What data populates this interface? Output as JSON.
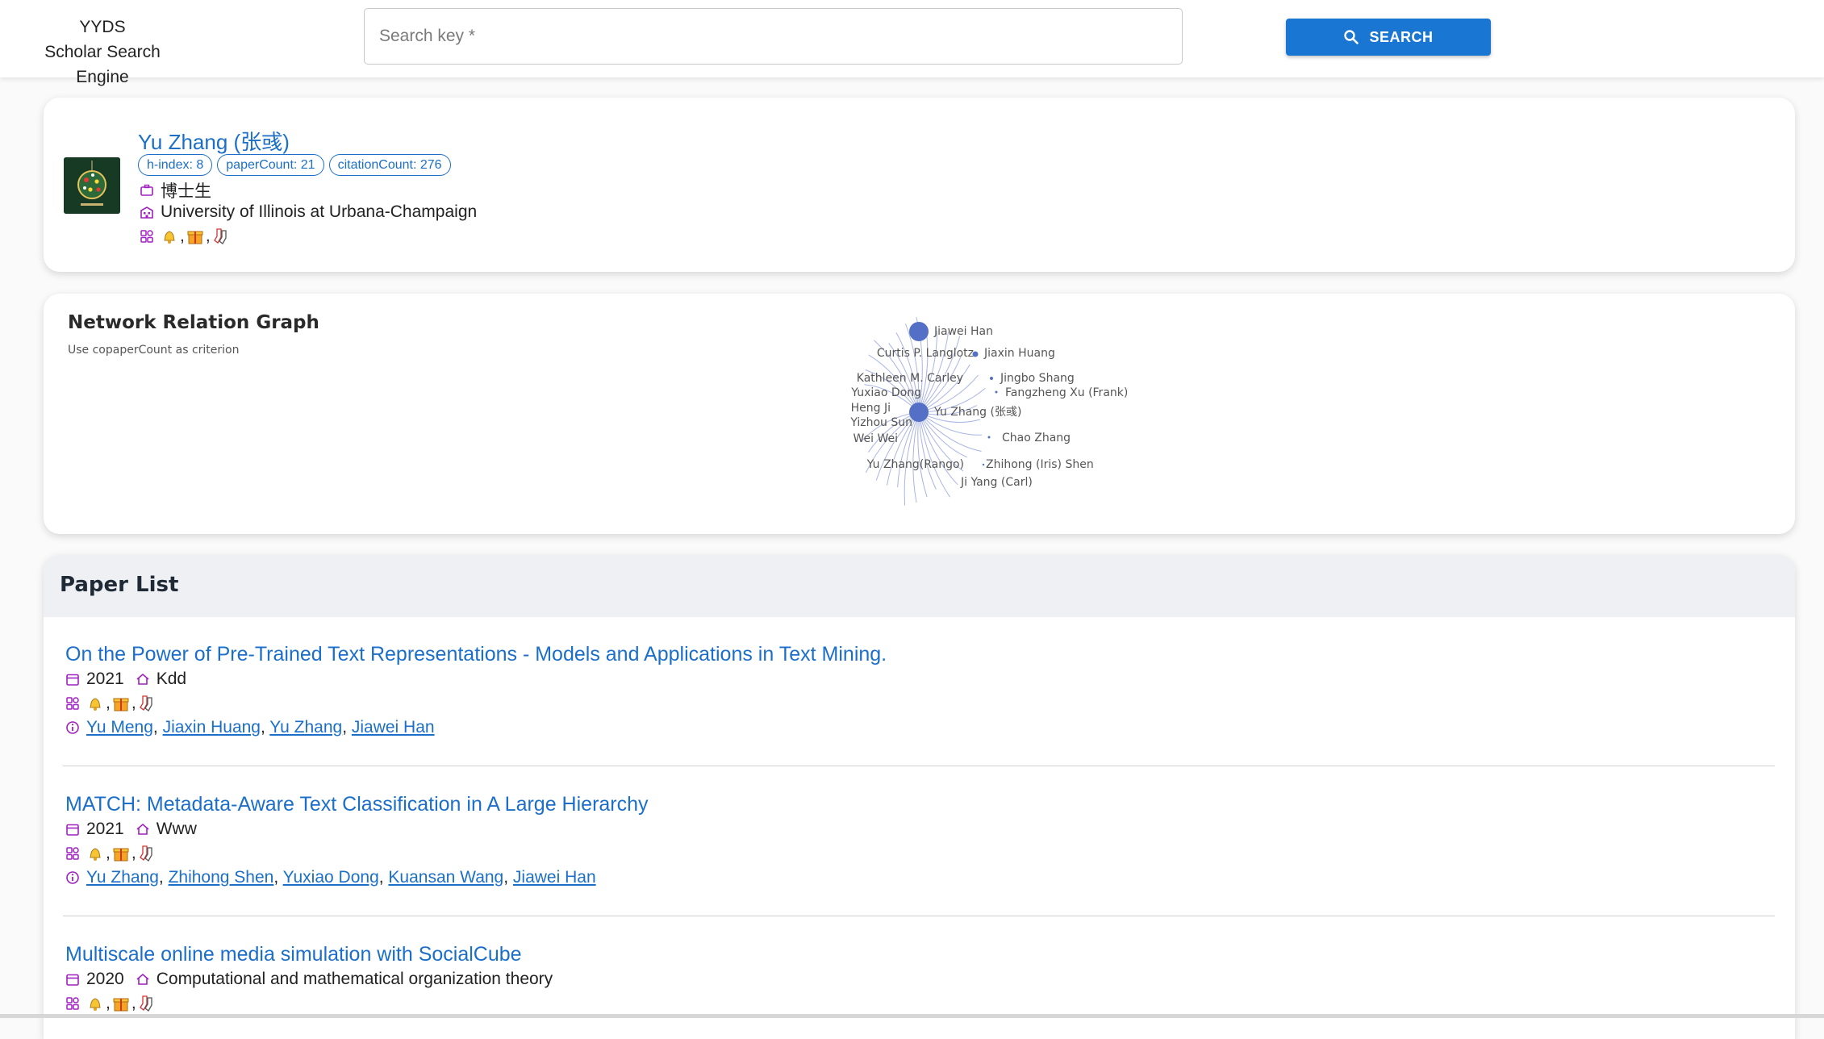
{
  "header": {
    "brand_line1": "YYDS",
    "brand_line2": "Scholar Search Engine",
    "search_placeholder": "Search key *",
    "search_value": "",
    "search_button": "SEARCH"
  },
  "profile": {
    "name": "Yu Zhang (张彧)",
    "chips": [
      "h-index: 8",
      "paperCount: 21",
      "citationCount: 276"
    ],
    "position": "博士生",
    "affiliation": "University of Illinois at Urbana-Champaign",
    "interest_icons": [
      "bell-emoji",
      "gift-emoji",
      "socks-emoji"
    ]
  },
  "graph": {
    "title": "Network Relation Graph",
    "subtitle": "Use copaperCount as criterion",
    "center": "Yu Zhang (张彧)",
    "nodes": [
      "Jiawei Han",
      "Curtis P. Langlotz",
      "Jiaxin Huang",
      "Kathleen M. Carley",
      "Jingbo Shang",
      "Yuxiao Dong",
      "Fangzheng Xu (Frank)",
      "Heng Ji",
      "Yizhou Sun",
      "Wei Wei",
      "Chao Zhang",
      "Yu Zhang(Rango)",
      "Zhihong (Iris) Shen",
      "Ji Yang (Carl)"
    ],
    "node_color": "#5470c6",
    "edge_color": "#a9b5e4"
  },
  "papers": {
    "heading": "Paper List",
    "items": [
      {
        "title": "On the Power of Pre-Trained Text Representations - Models and Applications in Text Mining.",
        "year": "2021",
        "venue": "Kdd",
        "authors": [
          "Yu Meng",
          "Jiaxin Huang",
          "Yu Zhang",
          "Jiawei Han"
        ]
      },
      {
        "title": "MATCH: Metadata-Aware Text Classification in A Large Hierarchy",
        "year": "2021",
        "venue": "Www",
        "authors": [
          "Yu Zhang",
          "Zhihong Shen",
          "Yuxiao Dong",
          "Kuansan Wang",
          "Jiawei Han"
        ]
      },
      {
        "title": "Multiscale online media simulation with SocialCube",
        "year": "2020",
        "venue": "Computational and mathematical organization theory",
        "authors": []
      }
    ]
  },
  "colors": {
    "accent": "#1976d2",
    "link": "#1b6fc8",
    "icon": "#a020c0"
  }
}
